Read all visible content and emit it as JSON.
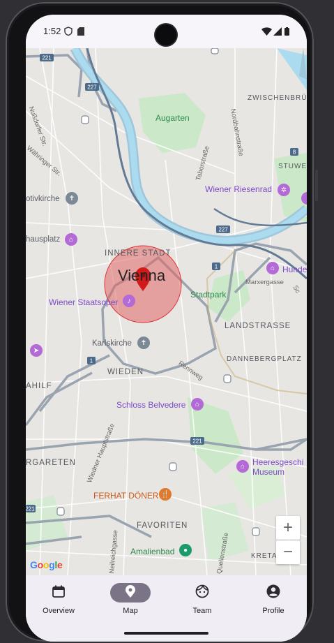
{
  "status_bar": {
    "time": "1:52"
  },
  "map": {
    "city_label": "Vienna",
    "district_labels": [
      "INNERE STADT",
      "LANDSTRASSE",
      "WIEDEN",
      "FAVORITEN",
      "DANNEBERGPLATZ",
      "ZWISCHENBRÜC",
      "STUWE",
      "AHILF",
      "RGARETEN",
      "KRETA"
    ],
    "place_labels": {
      "augarten": "Augarten",
      "riesenrad": "Wiener Riesenrad",
      "votivkirche": "otivkirche",
      "hausplatz": "hausplatz",
      "staatsoper": "Wiener Staatsoper",
      "stadtpark": "Stadtpark",
      "hundert": "Hunde",
      "karlskirche": "Karlskirche",
      "belvedere": "Schloss Belvedere",
      "heeresgeschichtliches": "Heeresgeschi",
      "museum": "Museum",
      "ferhat": "FERHAT DÖNER",
      "amalienbad": "Amalienbad"
    },
    "street_labels": [
      "Nußdorfer Str.",
      "Währinger Str.",
      "Taborstraße",
      "Nordbahnstraße",
      "Marxergasse",
      "Rennweg",
      "Wiedner Hauptstraße",
      "Neilreichgasse",
      "Quellenstraße",
      "Sc"
    ],
    "road_shields": [
      "221",
      "227",
      "227",
      "1",
      "1",
      "221",
      "8"
    ],
    "zoom_in": "+",
    "zoom_out": "−",
    "attribution": "Google"
  },
  "nav": {
    "items": [
      {
        "label": "Overview",
        "icon": "calendar-icon",
        "active": false
      },
      {
        "label": "Map",
        "icon": "location-pin-icon",
        "active": true
      },
      {
        "label": "Team",
        "icon": "face-icon",
        "active": false
      },
      {
        "label": "Profile",
        "icon": "account-circle-icon",
        "active": false
      }
    ]
  },
  "colors": {
    "accent_pill": "#7a7486",
    "marker_circle": "#e06666",
    "marker_pin": "#d11b1b",
    "water": "#aadbee",
    "park": "#cbe8c8"
  }
}
